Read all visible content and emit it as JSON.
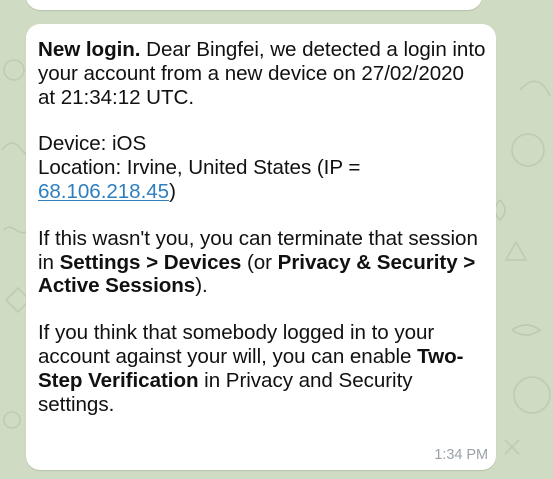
{
  "message": {
    "p1": {
      "heading": "New login.",
      "text": " Dear Bingfei, we detected a login into your account from a new device on 27/02/2020 at 21:34:12 UTC."
    },
    "p2": {
      "device": "Device: iOS",
      "location_prefix": "Location: Irvine, United States (IP =",
      "ip": "68.106.218.45",
      "close_paren": ")"
    },
    "p3": {
      "pre": "If this wasn't you, you can terminate that session in ",
      "settings_path": "Settings > Devices",
      "mid": " (or ",
      "privacy_path": "Privacy & Security > Active Sessions",
      "post": ")."
    },
    "p4": {
      "pre": "If you think that somebody logged in to your account against your will, you can enable ",
      "feature": "Two-Step Verification",
      "post": " in Privacy and Security settings."
    },
    "time": "1:34 PM"
  },
  "colors": {
    "chat_background": "#cfdbc3",
    "bubble": "#ffffff",
    "link": "#2f7fbf",
    "timestamp": "#9aa3a9"
  },
  "icons": [
    "chat-doodle-pattern"
  ]
}
